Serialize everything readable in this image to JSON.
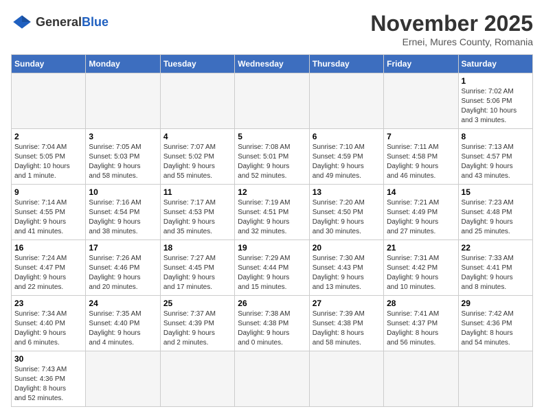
{
  "header": {
    "logo_general": "General",
    "logo_blue": "Blue",
    "month_title": "November 2025",
    "subtitle": "Ernei, Mures County, Romania"
  },
  "weekdays": [
    "Sunday",
    "Monday",
    "Tuesday",
    "Wednesday",
    "Thursday",
    "Friday",
    "Saturday"
  ],
  "days": [
    {
      "num": "",
      "info": "",
      "empty": true
    },
    {
      "num": "",
      "info": "",
      "empty": true
    },
    {
      "num": "",
      "info": "",
      "empty": true
    },
    {
      "num": "",
      "info": "",
      "empty": true
    },
    {
      "num": "",
      "info": "",
      "empty": true
    },
    {
      "num": "",
      "info": "",
      "empty": true
    },
    {
      "num": "1",
      "info": "Sunrise: 7:02 AM\nSunset: 5:06 PM\nDaylight: 10 hours\nand 3 minutes."
    },
    {
      "num": "2",
      "info": "Sunrise: 7:04 AM\nSunset: 5:05 PM\nDaylight: 10 hours\nand 1 minute."
    },
    {
      "num": "3",
      "info": "Sunrise: 7:05 AM\nSunset: 5:03 PM\nDaylight: 9 hours\nand 58 minutes."
    },
    {
      "num": "4",
      "info": "Sunrise: 7:07 AM\nSunset: 5:02 PM\nDaylight: 9 hours\nand 55 minutes."
    },
    {
      "num": "5",
      "info": "Sunrise: 7:08 AM\nSunset: 5:01 PM\nDaylight: 9 hours\nand 52 minutes."
    },
    {
      "num": "6",
      "info": "Sunrise: 7:10 AM\nSunset: 4:59 PM\nDaylight: 9 hours\nand 49 minutes."
    },
    {
      "num": "7",
      "info": "Sunrise: 7:11 AM\nSunset: 4:58 PM\nDaylight: 9 hours\nand 46 minutes."
    },
    {
      "num": "8",
      "info": "Sunrise: 7:13 AM\nSunset: 4:57 PM\nDaylight: 9 hours\nand 43 minutes."
    },
    {
      "num": "9",
      "info": "Sunrise: 7:14 AM\nSunset: 4:55 PM\nDaylight: 9 hours\nand 41 minutes."
    },
    {
      "num": "10",
      "info": "Sunrise: 7:16 AM\nSunset: 4:54 PM\nDaylight: 9 hours\nand 38 minutes."
    },
    {
      "num": "11",
      "info": "Sunrise: 7:17 AM\nSunset: 4:53 PM\nDaylight: 9 hours\nand 35 minutes."
    },
    {
      "num": "12",
      "info": "Sunrise: 7:19 AM\nSunset: 4:51 PM\nDaylight: 9 hours\nand 32 minutes."
    },
    {
      "num": "13",
      "info": "Sunrise: 7:20 AM\nSunset: 4:50 PM\nDaylight: 9 hours\nand 30 minutes."
    },
    {
      "num": "14",
      "info": "Sunrise: 7:21 AM\nSunset: 4:49 PM\nDaylight: 9 hours\nand 27 minutes."
    },
    {
      "num": "15",
      "info": "Sunrise: 7:23 AM\nSunset: 4:48 PM\nDaylight: 9 hours\nand 25 minutes."
    },
    {
      "num": "16",
      "info": "Sunrise: 7:24 AM\nSunset: 4:47 PM\nDaylight: 9 hours\nand 22 minutes."
    },
    {
      "num": "17",
      "info": "Sunrise: 7:26 AM\nSunset: 4:46 PM\nDaylight: 9 hours\nand 20 minutes."
    },
    {
      "num": "18",
      "info": "Sunrise: 7:27 AM\nSunset: 4:45 PM\nDaylight: 9 hours\nand 17 minutes."
    },
    {
      "num": "19",
      "info": "Sunrise: 7:29 AM\nSunset: 4:44 PM\nDaylight: 9 hours\nand 15 minutes."
    },
    {
      "num": "20",
      "info": "Sunrise: 7:30 AM\nSunset: 4:43 PM\nDaylight: 9 hours\nand 13 minutes."
    },
    {
      "num": "21",
      "info": "Sunrise: 7:31 AM\nSunset: 4:42 PM\nDaylight: 9 hours\nand 10 minutes."
    },
    {
      "num": "22",
      "info": "Sunrise: 7:33 AM\nSunset: 4:41 PM\nDaylight: 9 hours\nand 8 minutes."
    },
    {
      "num": "23",
      "info": "Sunrise: 7:34 AM\nSunset: 4:40 PM\nDaylight: 9 hours\nand 6 minutes."
    },
    {
      "num": "24",
      "info": "Sunrise: 7:35 AM\nSunset: 4:40 PM\nDaylight: 9 hours\nand 4 minutes."
    },
    {
      "num": "25",
      "info": "Sunrise: 7:37 AM\nSunset: 4:39 PM\nDaylight: 9 hours\nand 2 minutes."
    },
    {
      "num": "26",
      "info": "Sunrise: 7:38 AM\nSunset: 4:38 PM\nDaylight: 9 hours\nand 0 minutes."
    },
    {
      "num": "27",
      "info": "Sunrise: 7:39 AM\nSunset: 4:38 PM\nDaylight: 8 hours\nand 58 minutes."
    },
    {
      "num": "28",
      "info": "Sunrise: 7:41 AM\nSunset: 4:37 PM\nDaylight: 8 hours\nand 56 minutes."
    },
    {
      "num": "29",
      "info": "Sunrise: 7:42 AM\nSunset: 4:36 PM\nDaylight: 8 hours\nand 54 minutes."
    },
    {
      "num": "30",
      "info": "Sunrise: 7:43 AM\nSunset: 4:36 PM\nDaylight: 8 hours\nand 52 minutes."
    },
    {
      "num": "",
      "info": "",
      "empty": true
    },
    {
      "num": "",
      "info": "",
      "empty": true
    },
    {
      "num": "",
      "info": "",
      "empty": true
    },
    {
      "num": "",
      "info": "",
      "empty": true
    },
    {
      "num": "",
      "info": "",
      "empty": true
    },
    {
      "num": "",
      "info": "",
      "empty": true
    }
  ]
}
